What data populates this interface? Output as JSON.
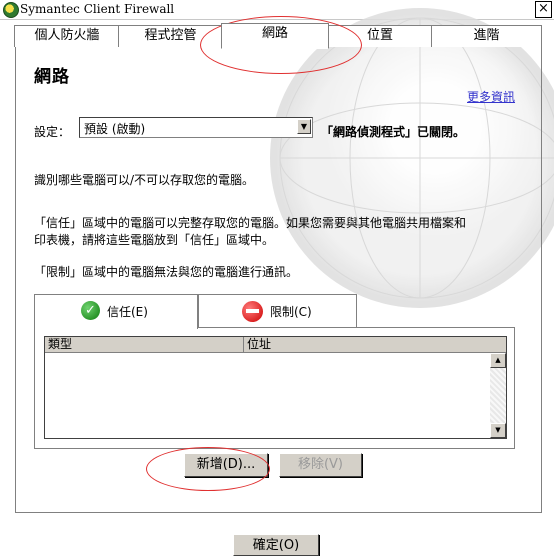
{
  "window": {
    "title": "Symantec Client Firewall",
    "close_glyph": "×"
  },
  "main_tabs": [
    {
      "label": "個人防火牆"
    },
    {
      "label": "程式控管"
    },
    {
      "label": "網路"
    },
    {
      "label": "位置"
    },
    {
      "label": "進階"
    }
  ],
  "page": {
    "title": "網路",
    "more_info": "更多資訊",
    "setting_label": "設定：",
    "setting_value": "預設 (啟動)",
    "detector_status": "「網路偵測程式」已關閉。",
    "intro": "識別哪些電腦可以/不可以存取您的電腦。",
    "trusted_desc_1": "「信任」區域中的電腦可以完整存取您的電腦。如果您需要與其他電腦共用檔案和",
    "trusted_desc_2": "印表機，請將這些電腦放到「信任」區域中。",
    "restricted_desc": "「限制」區域中的電腦無法與您的電腦進行通訊。"
  },
  "zone_tabs": [
    {
      "label": "信任(E)",
      "icon": "check-circle-icon",
      "color": "#0c7a0c"
    },
    {
      "label": "限制(C)",
      "icon": "no-entry-icon",
      "color": "#cc0000"
    }
  ],
  "list": {
    "columns": [
      "類型",
      "位址"
    ],
    "rows": []
  },
  "buttons": {
    "add": "新增(D)...",
    "remove": "移除(V)",
    "ok": "確定(O)"
  },
  "annotation_color": "#e03030"
}
